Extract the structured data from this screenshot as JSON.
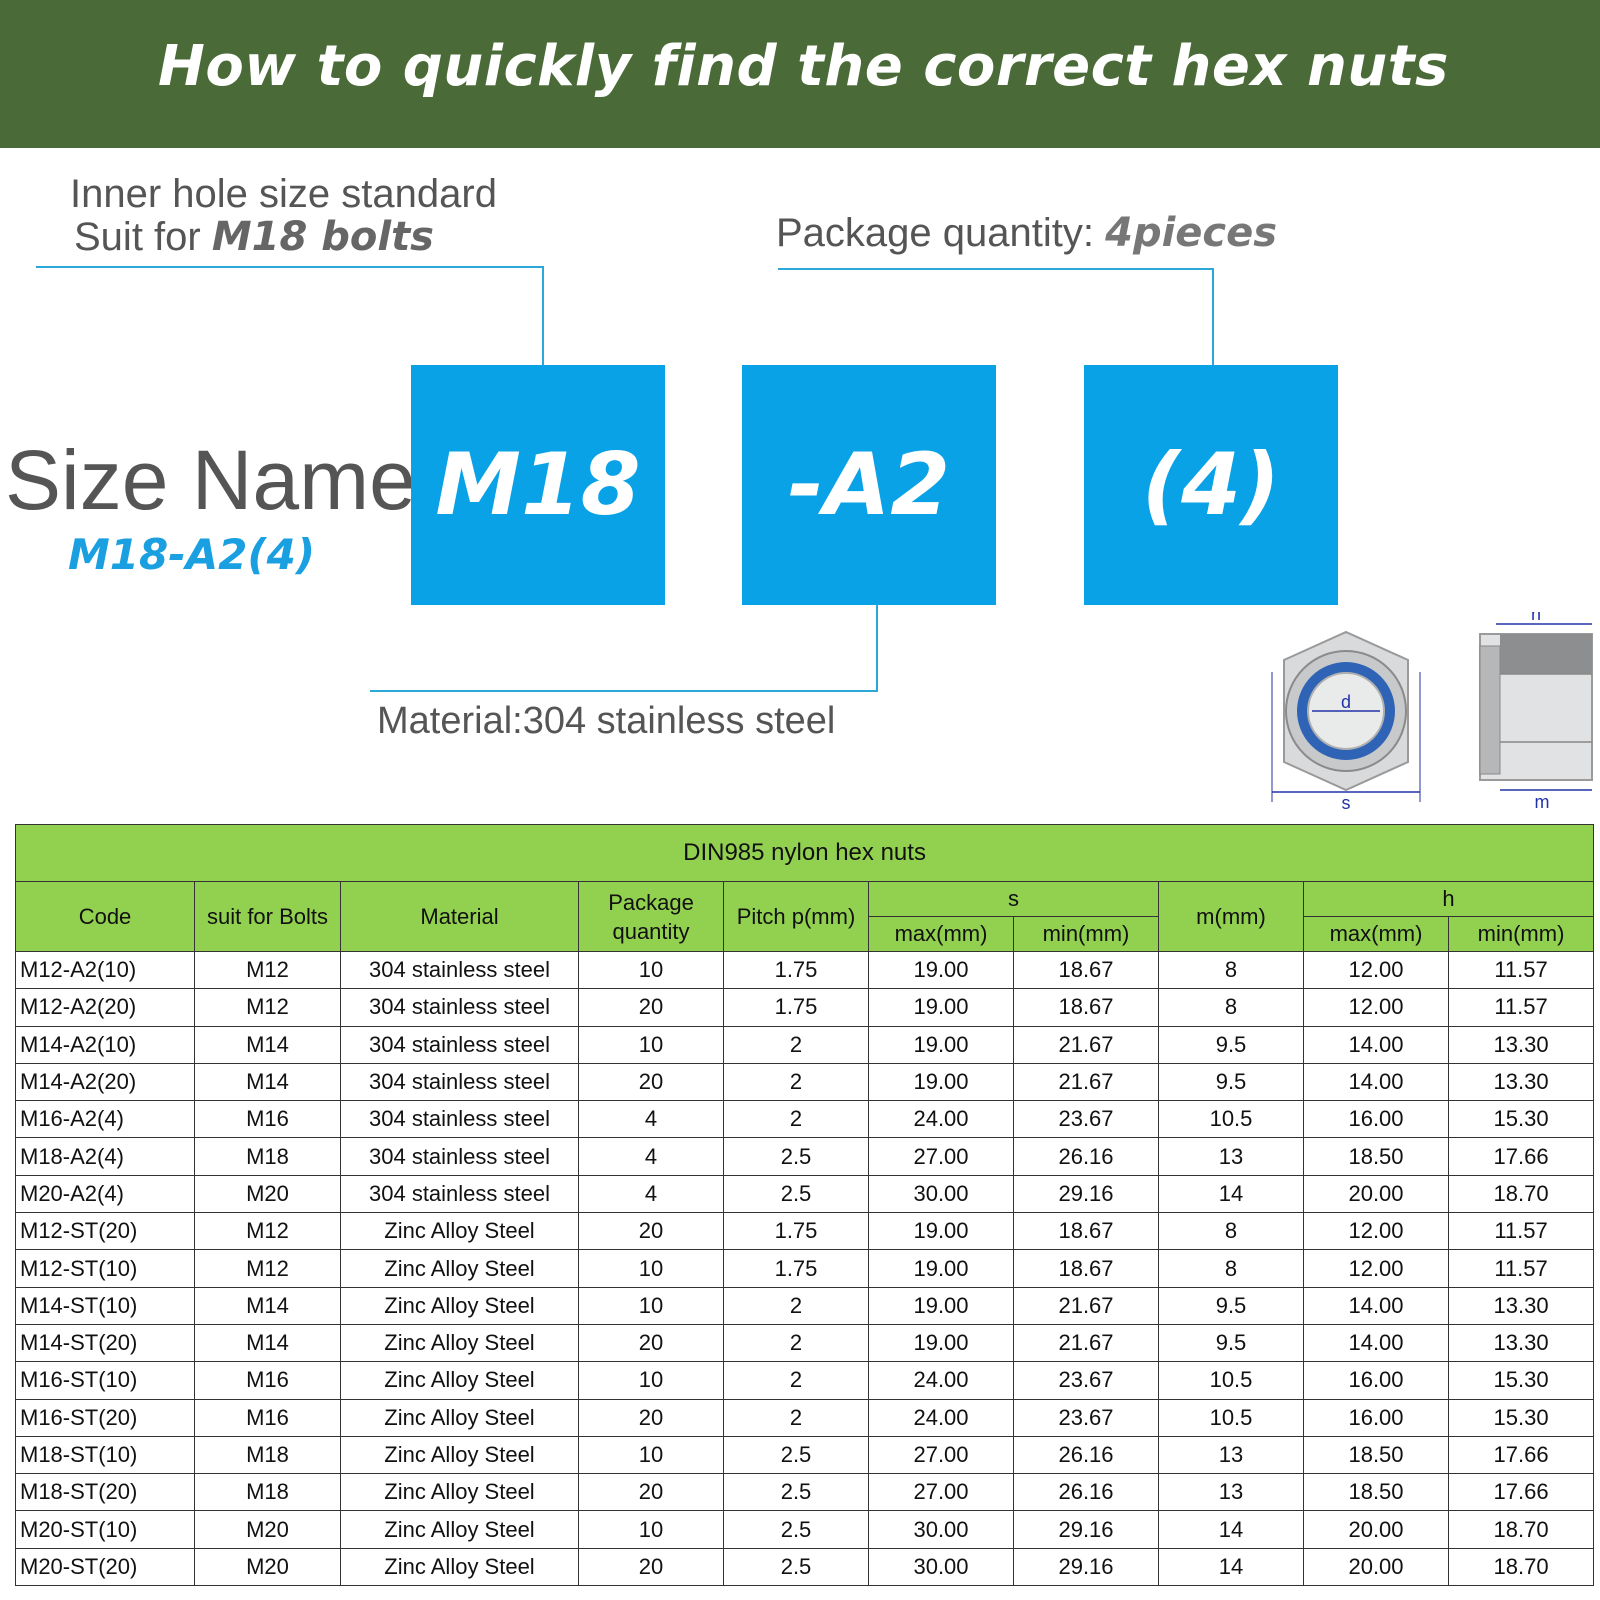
{
  "banner": {
    "title": "How to quickly find the correct hex nuts"
  },
  "annotations": {
    "inner_line1": "Inner hole size standard",
    "inner_line2_prefix": "Suit for ",
    "inner_line2_emphasis": "M18 bolts",
    "package_prefix": "Package quantity:",
    "package_emphasis": "4pieces",
    "material": "Material:304 stainless steel"
  },
  "size_name": {
    "label": "Size Name:",
    "example": "M18-A2(4)",
    "boxes": [
      "M18",
      "-A2",
      "(4)"
    ]
  },
  "diagram_labels": {
    "d": "d",
    "s": "s",
    "h": "h",
    "m": "m"
  },
  "colors": {
    "banner": "#4a6a37",
    "box": "#0aa2e6",
    "table_header": "#92d050",
    "accent": "#1aa0e0"
  },
  "table": {
    "title": "DIN985 nylon hex nuts",
    "headers": {
      "code": "Code",
      "suit": "suit for Bolts",
      "material": "Material",
      "package": "Package quantity",
      "pitch": "Pitch p(mm)",
      "s": "s",
      "m": "m(mm)",
      "h": "h",
      "max": "max(mm)",
      "min": "min(mm)"
    },
    "rows": [
      [
        "M12-A2(10)",
        "M12",
        "304 stainless steel",
        "10",
        "1.75",
        "19.00",
        "18.67",
        "8",
        "12.00",
        "11.57"
      ],
      [
        "M12-A2(20)",
        "M12",
        "304 stainless steel",
        "20",
        "1.75",
        "19.00",
        "18.67",
        "8",
        "12.00",
        "11.57"
      ],
      [
        "M14-A2(10)",
        "M14",
        "304 stainless steel",
        "10",
        "2",
        "19.00",
        "21.67",
        "9.5",
        "14.00",
        "13.30"
      ],
      [
        "M14-A2(20)",
        "M14",
        "304 stainless steel",
        "20",
        "2",
        "19.00",
        "21.67",
        "9.5",
        "14.00",
        "13.30"
      ],
      [
        "M16-A2(4)",
        "M16",
        "304 stainless steel",
        "4",
        "2",
        "24.00",
        "23.67",
        "10.5",
        "16.00",
        "15.30"
      ],
      [
        "M18-A2(4)",
        "M18",
        "304 stainless steel",
        "4",
        "2.5",
        "27.00",
        "26.16",
        "13",
        "18.50",
        "17.66"
      ],
      [
        "M20-A2(4)",
        "M20",
        "304 stainless steel",
        "4",
        "2.5",
        "30.00",
        "29.16",
        "14",
        "20.00",
        "18.70"
      ],
      [
        "M12-ST(20)",
        "M12",
        "Zinc Alloy Steel",
        "20",
        "1.75",
        "19.00",
        "18.67",
        "8",
        "12.00",
        "11.57"
      ],
      [
        "M12-ST(10)",
        "M12",
        "Zinc Alloy Steel",
        "10",
        "1.75",
        "19.00",
        "18.67",
        "8",
        "12.00",
        "11.57"
      ],
      [
        "M14-ST(10)",
        "M14",
        "Zinc Alloy Steel",
        "10",
        "2",
        "19.00",
        "21.67",
        "9.5",
        "14.00",
        "13.30"
      ],
      [
        "M14-ST(20)",
        "M14",
        "Zinc Alloy Steel",
        "20",
        "2",
        "19.00",
        "21.67",
        "9.5",
        "14.00",
        "13.30"
      ],
      [
        "M16-ST(10)",
        "M16",
        "Zinc Alloy Steel",
        "10",
        "2",
        "24.00",
        "23.67",
        "10.5",
        "16.00",
        "15.30"
      ],
      [
        "M16-ST(20)",
        "M16",
        "Zinc Alloy Steel",
        "20",
        "2",
        "24.00",
        "23.67",
        "10.5",
        "16.00",
        "15.30"
      ],
      [
        "M18-ST(10)",
        "M18",
        "Zinc Alloy Steel",
        "10",
        "2.5",
        "27.00",
        "26.16",
        "13",
        "18.50",
        "17.66"
      ],
      [
        "M18-ST(20)",
        "M18",
        "Zinc Alloy Steel",
        "20",
        "2.5",
        "27.00",
        "26.16",
        "13",
        "18.50",
        "17.66"
      ],
      [
        "M20-ST(10)",
        "M20",
        "Zinc Alloy Steel",
        "10",
        "2.5",
        "30.00",
        "29.16",
        "14",
        "20.00",
        "18.70"
      ],
      [
        "M20-ST(20)",
        "M20",
        "Zinc Alloy Steel",
        "20",
        "2.5",
        "30.00",
        "29.16",
        "14",
        "20.00",
        "18.70"
      ]
    ]
  }
}
